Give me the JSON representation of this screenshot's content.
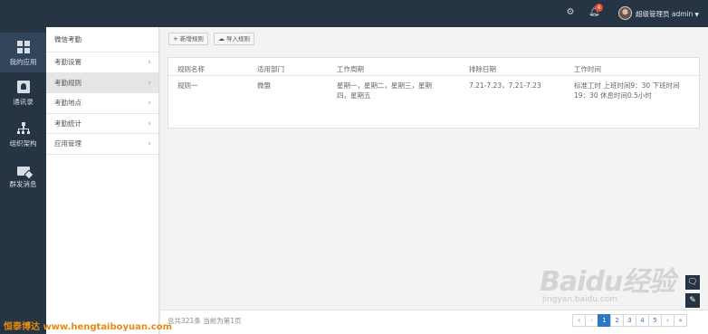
{
  "topbar": {
    "notification_count": "4",
    "user_label": "超级管理员 admin",
    "icons": {
      "settings": "settings-icon",
      "bell": "bell-icon",
      "caret": "caret-down-icon"
    }
  },
  "leftnav": {
    "items": [
      {
        "label": "我的应用",
        "icon": "apps-grid-icon"
      },
      {
        "label": "通讯录",
        "icon": "contacts-book-icon"
      },
      {
        "label": "组织架构",
        "icon": "org-tree-icon"
      },
      {
        "label": "群发消息",
        "icon": "message-icon"
      }
    ]
  },
  "subnav": {
    "title": "微信考勤",
    "items": [
      {
        "label": "考勤设置"
      },
      {
        "label": "考勤规则"
      },
      {
        "label": "考勤地点"
      },
      {
        "label": "考勤统计"
      },
      {
        "label": "应用管理"
      }
    ]
  },
  "toolbar": {
    "add_label": "新增规则",
    "import_label": "导入规则"
  },
  "table": {
    "headers": [
      "规则名称",
      "适用部门",
      "工作周期",
      "排除日期",
      "工作时间"
    ],
    "rows": [
      {
        "name": "规则一",
        "dept": "微盟",
        "cycle": "星期一，星期二，星期三，星期四，星期五",
        "exclude": "7.21-7.23，7.21-7.23",
        "time": "标准工时 上班时间9：30 下班时间19：30 休息时间0.5小时"
      }
    ]
  },
  "footer": {
    "info": "总共321条 当前为第1页",
    "pages": [
      "«",
      "‹",
      "1",
      "2",
      "3",
      "4",
      "5",
      "›",
      "»"
    ],
    "current_page": "1"
  },
  "watermark": {
    "left_text": "恒泰博达 www.hengtaiboyuan.com",
    "right_big": "Baidu经验",
    "right_small": "jingyan.baidu.com"
  }
}
